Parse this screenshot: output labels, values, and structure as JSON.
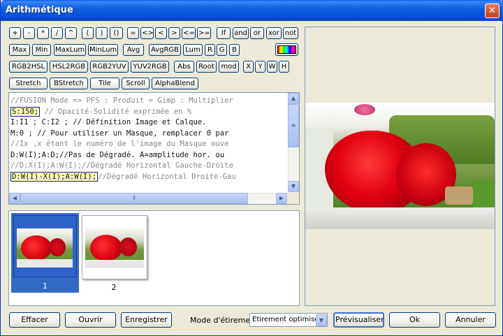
{
  "window": {
    "title": "Arithmétique",
    "close": "✕"
  },
  "ops_row1": [
    "+",
    "-",
    "*",
    "/",
    "^",
    "(",
    ")",
    "()",
    "=",
    "<>",
    "<",
    ">",
    "<=",
    ">=",
    "If",
    "and",
    "or",
    "xor",
    "not"
  ],
  "ops_row2": [
    "Max",
    "Min",
    "MaxLum",
    "MinLum",
    "Avg",
    "AvgRGB",
    "Lum",
    "R",
    "G",
    "B"
  ],
  "ops_row3": [
    "RGB2HSL",
    "HSL2RGB",
    "RGB2YUV",
    "YUV2RGB",
    "Abs",
    "Root",
    "mod",
    "X",
    "Y",
    "W",
    "H"
  ],
  "ops_row4": [
    "Stretch",
    "BStretch",
    "Tile",
    "Scroll",
    "AlphaBlend"
  ],
  "code": {
    "l1": "//FUSION Mode => PFS : Produit = Gimp : Multiplier",
    "l2a": "S:150;",
    "l2b": " // Opacité-Solidité exprimée en %",
    "l3": "I:I1 ; C:I2 ; // Définition Image et Calque.",
    "l4": "M:0 ; // Pour utiliser un Masque, remplacer 0 par",
    "l5": "//Ix ,x étant le numéro de l'image du Masque ouve",
    "l6": "D:W(I);A:D;//Pas de Dégradé. A=amplitude hor. ou",
    "l7": "//D:X(I);A:W(I);//Dégradé Horizontal Gauche-Droite",
    "l8a": "D:W(I)-X(I);A:W(I);",
    "l8b": "//Dégradé Horizontal Droite-Gau"
  },
  "thumbs": [
    {
      "label": "1"
    },
    {
      "label": "2"
    }
  ],
  "bottom": {
    "clear": "Effacer",
    "open": "Ouvrir",
    "save": "Enregistrer",
    "mode_label": "Mode d'étirement",
    "mode_value": "Etirement optimisé",
    "preview": "Prévisualiser",
    "ok": "Ok",
    "cancel": "Annuler"
  }
}
